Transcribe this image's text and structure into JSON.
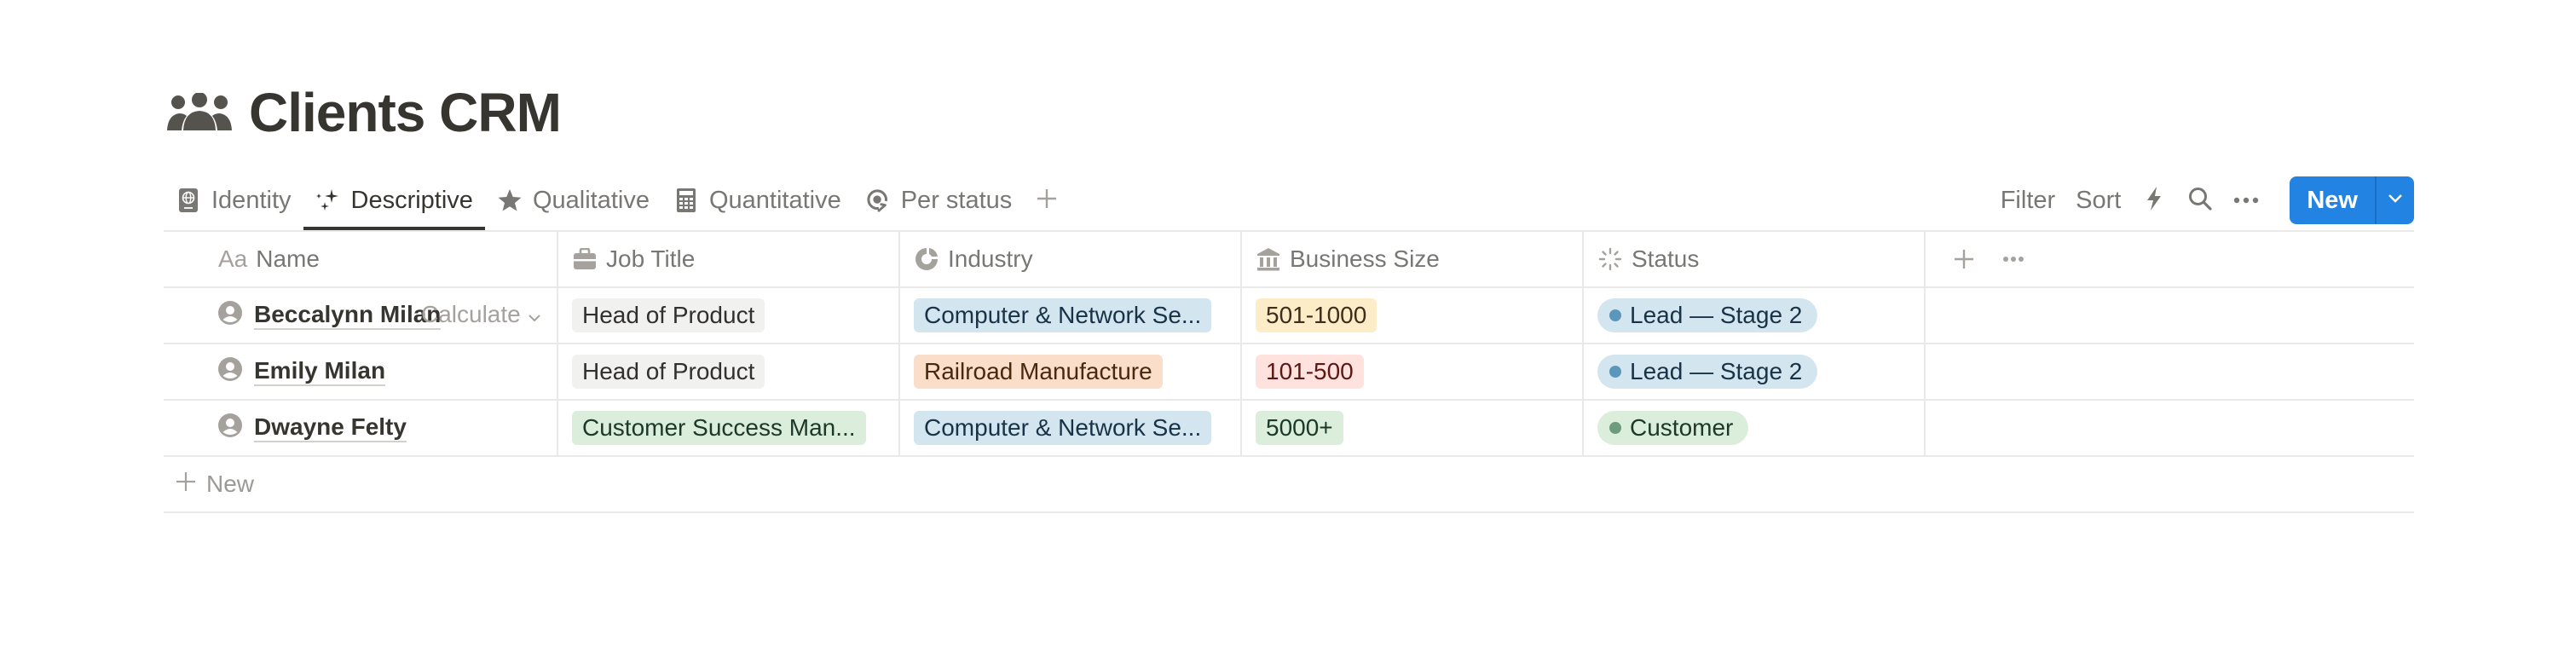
{
  "page": {
    "title": "Clients CRM",
    "title_icon": "people-group-icon"
  },
  "views": [
    {
      "label": "Identity",
      "icon": "passport-icon",
      "active": false
    },
    {
      "label": "Descriptive",
      "icon": "sparkles-icon",
      "active": true
    },
    {
      "label": "Qualitative",
      "icon": "star-icon",
      "active": false
    },
    {
      "label": "Quantitative",
      "icon": "calculator-icon",
      "active": false
    },
    {
      "label": "Per status",
      "icon": "target-arrow-icon",
      "active": false
    }
  ],
  "toolbar": {
    "filter_label": "Filter",
    "sort_label": "Sort",
    "new_label": "New"
  },
  "table": {
    "columns": [
      {
        "label": "Name",
        "icon": "text-type-icon"
      },
      {
        "label": "Job Title",
        "icon": "briefcase-icon"
      },
      {
        "label": "Industry",
        "icon": "pie-icon"
      },
      {
        "label": "Business Size",
        "icon": "bank-icon"
      },
      {
        "label": "Status",
        "icon": "status-loader-icon"
      }
    ],
    "rows": [
      {
        "name": "Beccalynn Milan",
        "job_title": "Head of Product",
        "industry": "Computer & Network Se...",
        "business_size": "501-1000",
        "status": "Lead — Stage 2"
      },
      {
        "name": "Emily Milan",
        "job_title": "Head of Product",
        "industry": "Railroad Manufacture",
        "business_size": "101-500",
        "status": "Lead — Stage 2"
      },
      {
        "name": "Dwayne Felty",
        "job_title": "Customer Success Man...",
        "industry": "Computer & Network Se...",
        "business_size": "5000+",
        "status": "Customer"
      }
    ],
    "new_row_label": "New",
    "calculate_label": "Calculate"
  },
  "colors": {
    "accent": "#2383e2",
    "tag_gray_bg": "#f1f1ef",
    "tag_gray_fg": "#32302c",
    "tag_blue_bg": "#d3e5ef",
    "tag_blue_fg": "#183347",
    "tag_orange_bg": "#fadec9",
    "tag_orange_fg": "#49290e",
    "tag_yellow_bg": "#fdecc8",
    "tag_yellow_fg": "#402c1b",
    "tag_red_bg": "#ffe2dd",
    "tag_red_fg": "#5d1715",
    "tag_green_bg": "#dbeddb",
    "tag_green_fg": "#1c3829",
    "status_blue_dot": "#5b97bd",
    "status_green_dot": "#6c9b7d"
  }
}
